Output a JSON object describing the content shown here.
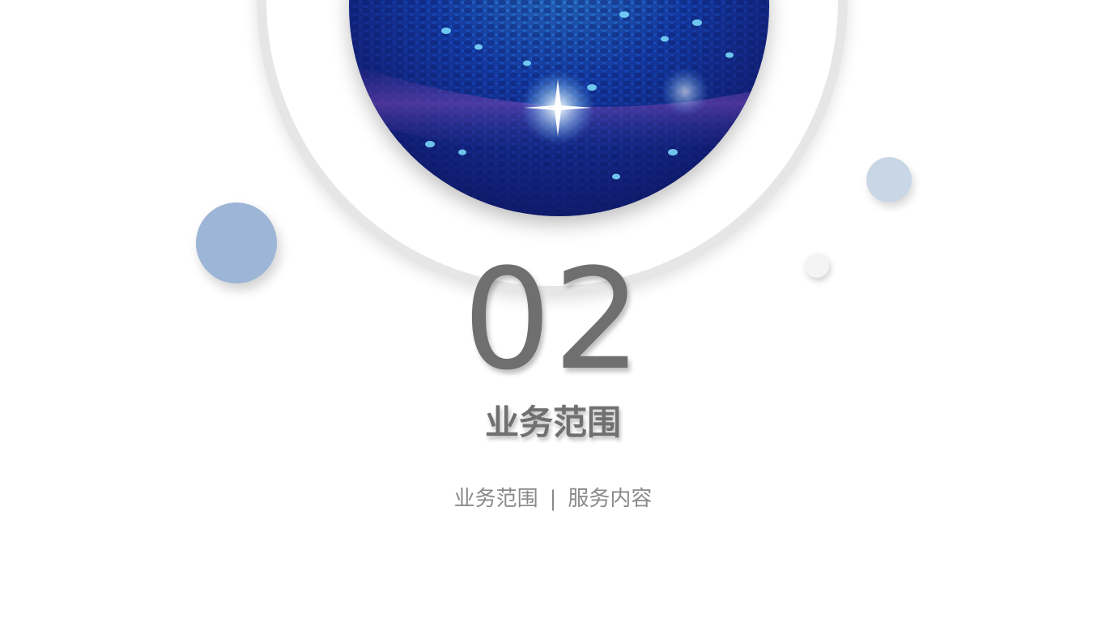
{
  "section": {
    "number": "02",
    "title": "业务范围",
    "subtitle_left": "业务范围",
    "subtitle_separator": "|",
    "subtitle_right": "服务内容"
  },
  "decorations": {
    "sphere_image": "blue-mosaic-sphere",
    "accent_colors": {
      "blue_dot": "#9db5d6",
      "pale_dot": "#c9d6e6",
      "ring": "#e6e6e6",
      "text_dark": "#707070",
      "text_light": "#8a8a8a"
    }
  }
}
